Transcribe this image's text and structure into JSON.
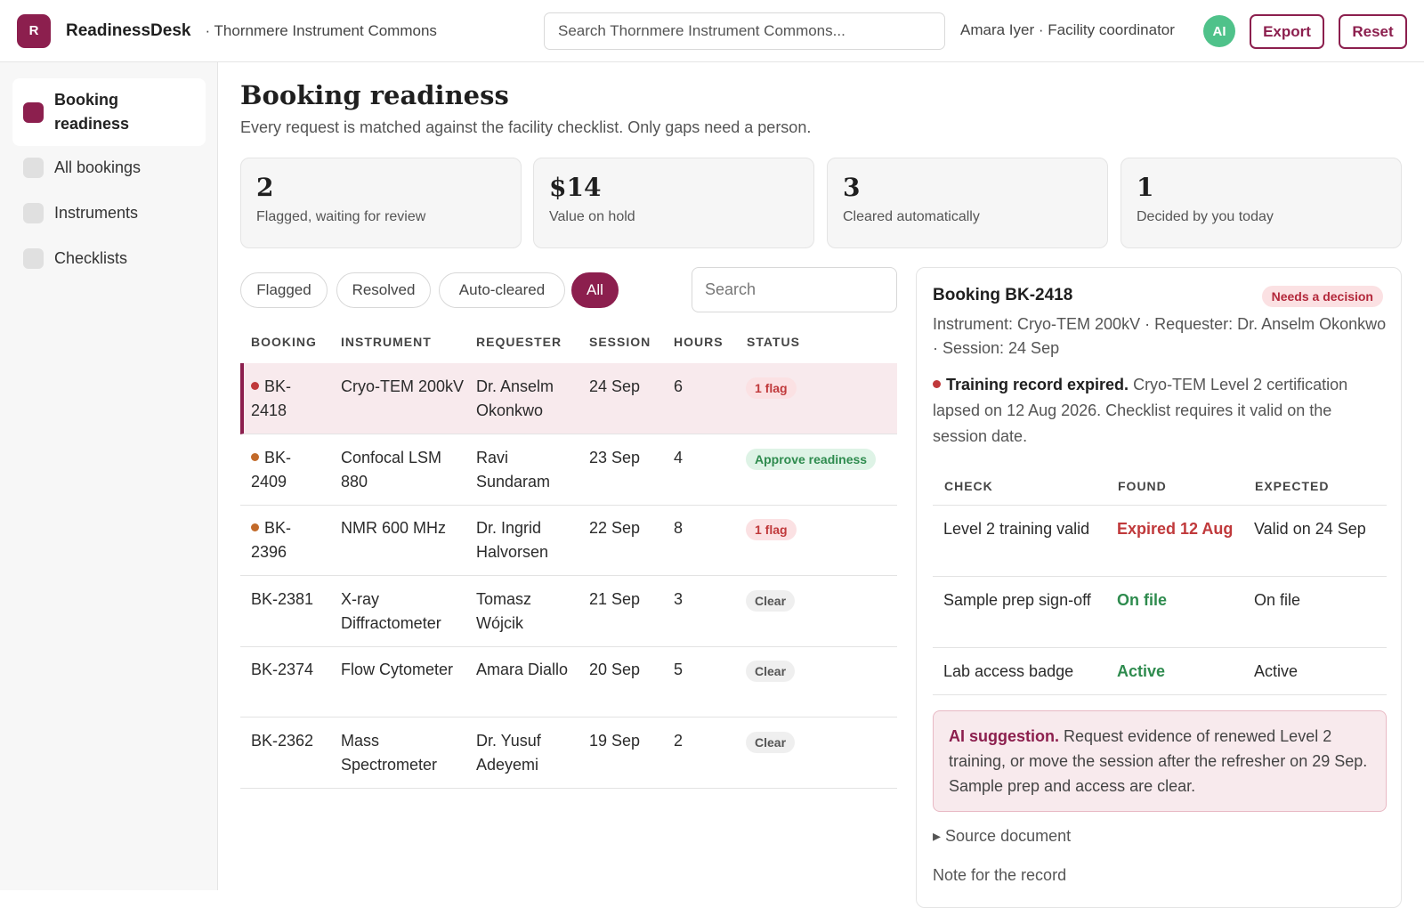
{
  "header": {
    "logo_letter": "R",
    "app_name": "ReadinessDesk",
    "facility": "· Thornmere Instrument Commons",
    "search_placeholder": "Search Thornmere Instrument Commons...",
    "user": "Amara Iyer · Facility coordinator",
    "avatar": "AI",
    "export_label": "Export",
    "reset_label": "Reset"
  },
  "sidebar": {
    "items": [
      {
        "label": "Booking readiness",
        "active": true
      },
      {
        "label": "All bookings",
        "active": false
      },
      {
        "label": "Instruments",
        "active": false
      },
      {
        "label": "Checklists",
        "active": false
      }
    ]
  },
  "page": {
    "title": "Booking readiness",
    "subtitle": "Every request is matched against the facility checklist. Only gaps need a person."
  },
  "stats": [
    {
      "value": "2",
      "label": "Flagged, waiting for review"
    },
    {
      "value": "$14",
      "label": "Value on hold"
    },
    {
      "value": "3",
      "label": "Cleared automatically"
    },
    {
      "value": "1",
      "label": "Decided by you today"
    }
  ],
  "filters": {
    "chips": [
      "Flagged",
      "Resolved",
      "Auto-cleared",
      "All"
    ],
    "active": "All",
    "search_placeholder": "Search"
  },
  "table": {
    "headers": [
      "BOOKING",
      "INSTRUMENT",
      "REQUESTER",
      "SESSION",
      "HOURS",
      "STATUS"
    ],
    "rows": [
      {
        "id": "BK-2418",
        "instrument": "Cryo-TEM 200kV",
        "requester": "Dr. Anselm Okonkwo",
        "session": "24 Sep",
        "hours": "6",
        "status": "1 flag",
        "status_kind": "flag",
        "dot": "#c0393b",
        "selected": true
      },
      {
        "id": "BK-2409",
        "instrument": "Confocal LSM 880",
        "requester": "Ravi Sundaram",
        "session": "23 Sep",
        "hours": "4",
        "status": "Approve readiness",
        "status_kind": "approve",
        "dot": "#c26a2a",
        "selected": false
      },
      {
        "id": "BK-2396",
        "instrument": "NMR 600 MHz",
        "requester": "Dr. Ingrid Halvorsen",
        "session": "22 Sep",
        "hours": "8",
        "status": "1 flag",
        "status_kind": "flag",
        "dot": "#c26a2a",
        "selected": false
      },
      {
        "id": "BK-2381",
        "instrument": "X-ray Diffractometer",
        "requester": "Tomasz Wójcik",
        "session": "21 Sep",
        "hours": "3",
        "status": "Clear",
        "status_kind": "clear",
        "dot": "",
        "selected": false
      },
      {
        "id": "BK-2374",
        "instrument": "Flow Cytometer",
        "requester": "Amara Diallo",
        "session": "20 Sep",
        "hours": "5",
        "status": "Clear",
        "status_kind": "clear",
        "dot": "",
        "selected": false
      },
      {
        "id": "BK-2362",
        "instrument": "Mass Spectrometer",
        "requester": "Dr. Yusuf Adeyemi",
        "session": "19 Sep",
        "hours": "2",
        "status": "Clear",
        "status_kind": "clear",
        "dot": "",
        "selected": false
      }
    ]
  },
  "detail": {
    "title": "Booking BK-2418",
    "badge": "Needs a decision",
    "meta": "Instrument: Cryo-TEM 200kV · Requester: Dr. Anselm Okonkwo · Session: 24 Sep",
    "alert_title": "Training record expired.",
    "alert_text": " Cryo-TEM Level 2 certification lapsed on 12 Aug 2026. Checklist requires it valid on the session date.",
    "check_headers": [
      "CHECK",
      "FOUND",
      "EXPECTED"
    ],
    "checks": [
      {
        "check": "Level 2 training valid",
        "found": "Expired 12 Aug",
        "found_kind": "bad",
        "expected": "Valid on 24 Sep"
      },
      {
        "check": "Sample prep sign-off",
        "found": "On file",
        "found_kind": "good",
        "expected": "On file"
      },
      {
        "check": "Lab access badge",
        "found": "Active",
        "found_kind": "good",
        "expected": "Active"
      }
    ],
    "ai_label": "AI suggestion.",
    "ai_text": " Request evidence of renewed Level 2 training, or move the session after the refresher on 29 Sep. Sample prep and access are clear.",
    "source_label": "▸ Source document",
    "note_label": "Note for the record"
  }
}
